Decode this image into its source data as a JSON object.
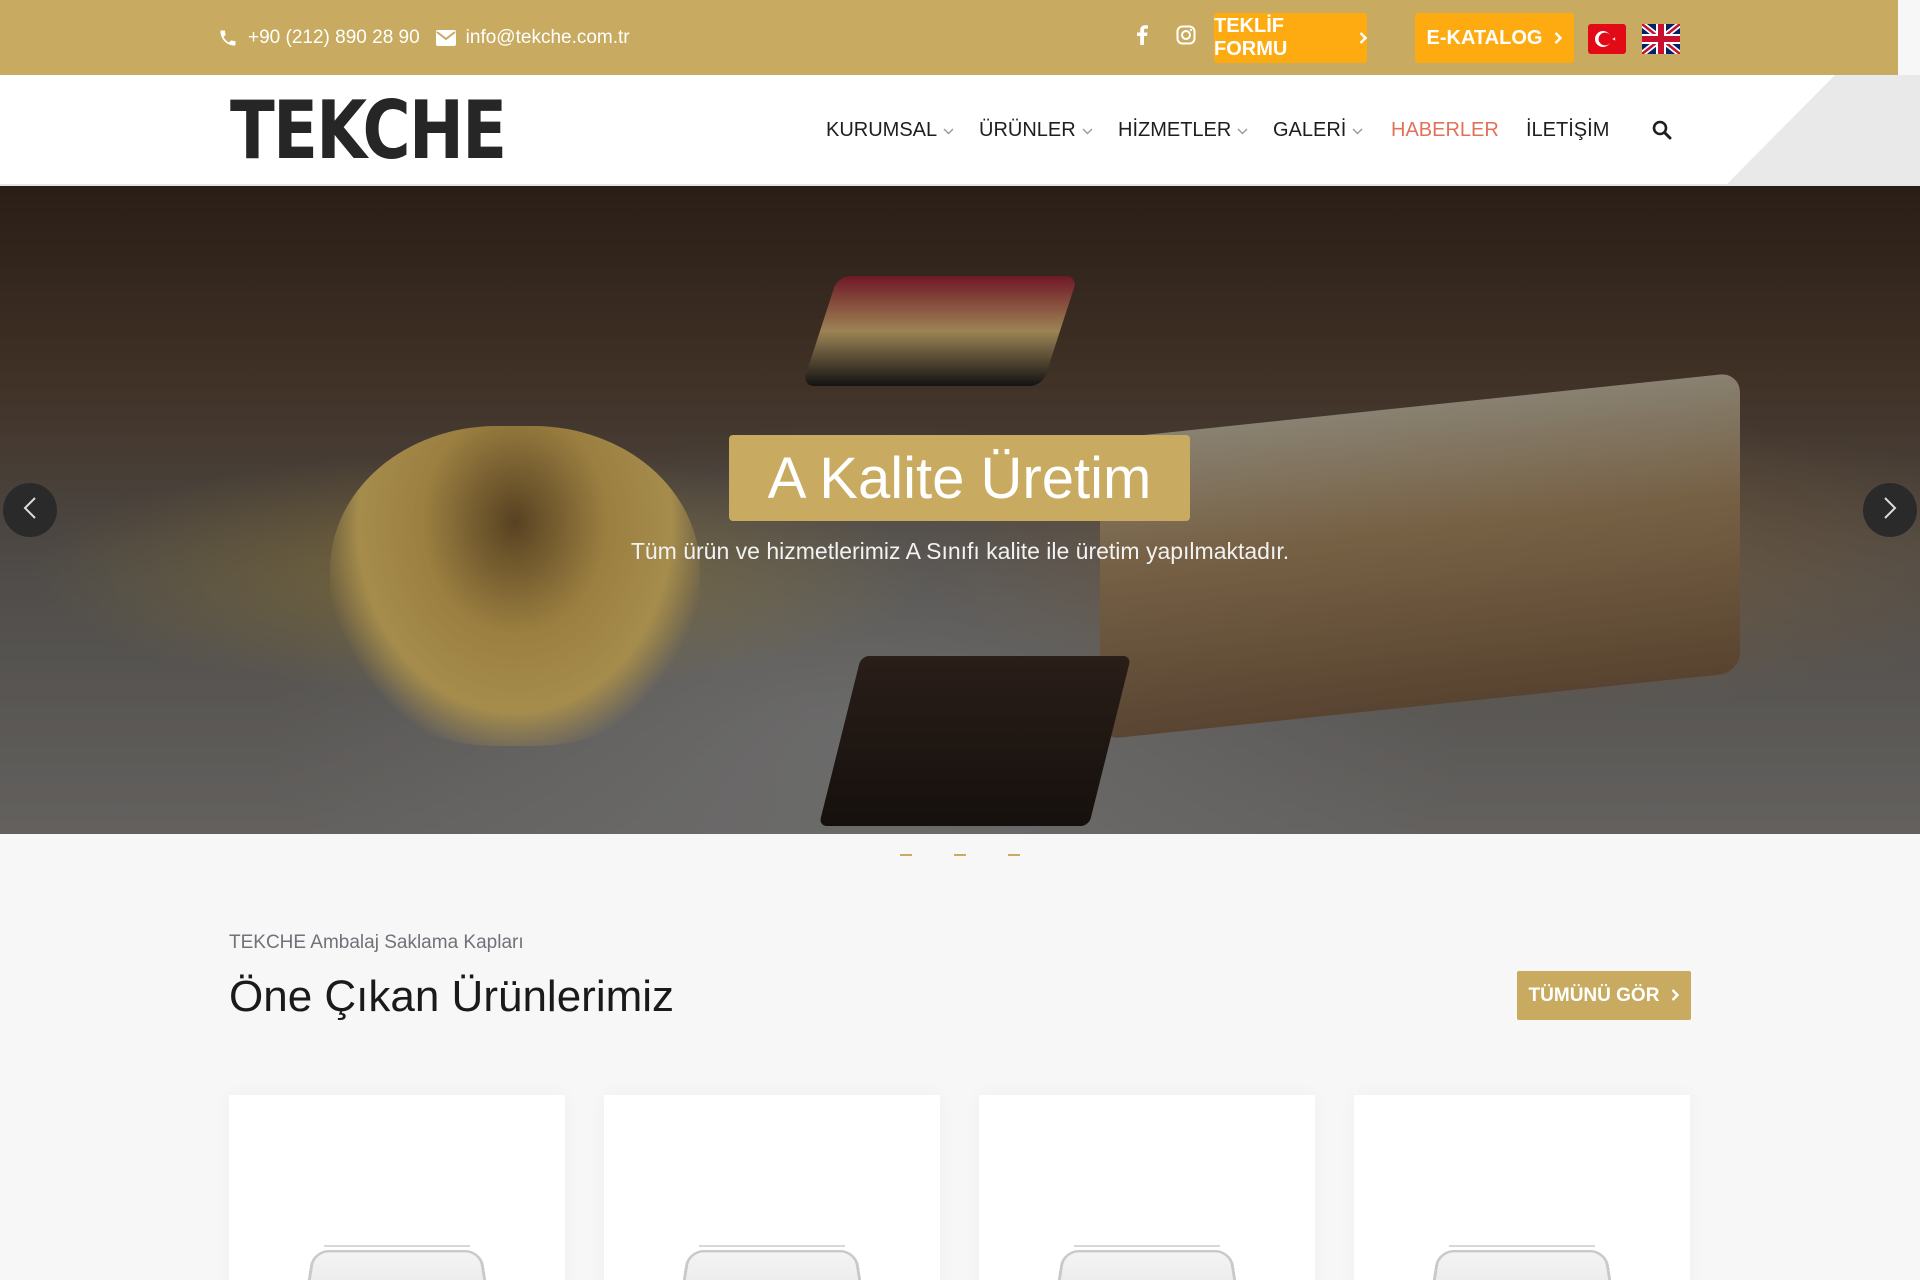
{
  "topbar": {
    "phone": "+90 (212) 890 28 90",
    "email": "info@tekche.com.tr",
    "social": [
      "facebook-icon",
      "instagram-icon"
    ],
    "teklif_label": "TEKLİF FORMU",
    "katalog_label": "E-KATALOG",
    "languages": [
      "Türkçe",
      "English"
    ],
    "colors": {
      "bar": "#c8ab60",
      "button": "#fdab11"
    }
  },
  "header": {
    "logo": "TEKCHE",
    "nav": [
      {
        "label": "KURUMSAL",
        "dropdown": true
      },
      {
        "label": "ÜRÜNLER",
        "dropdown": true
      },
      {
        "label": "HİZMETLER",
        "dropdown": true
      },
      {
        "label": "GALERİ",
        "dropdown": true
      },
      {
        "label": "HABERLER",
        "dropdown": false,
        "active": true
      },
      {
        "label": "İLETİŞİM",
        "dropdown": false
      }
    ],
    "active_color": "#e1725a"
  },
  "hero": {
    "title": "A Kalite Üretim",
    "subtitle": "Tüm ürün ve hizmetlerimiz A Sınıfı kalite ile üretim yapılmaktadır.",
    "slide_count": 3
  },
  "featured": {
    "kicker": "TEKCHE Ambalaj Saklama Kapları",
    "title": "Öne Çıkan Ürünlerimiz",
    "all_label": "TÜMÜNÜ GÖR",
    "card_count": 4
  }
}
